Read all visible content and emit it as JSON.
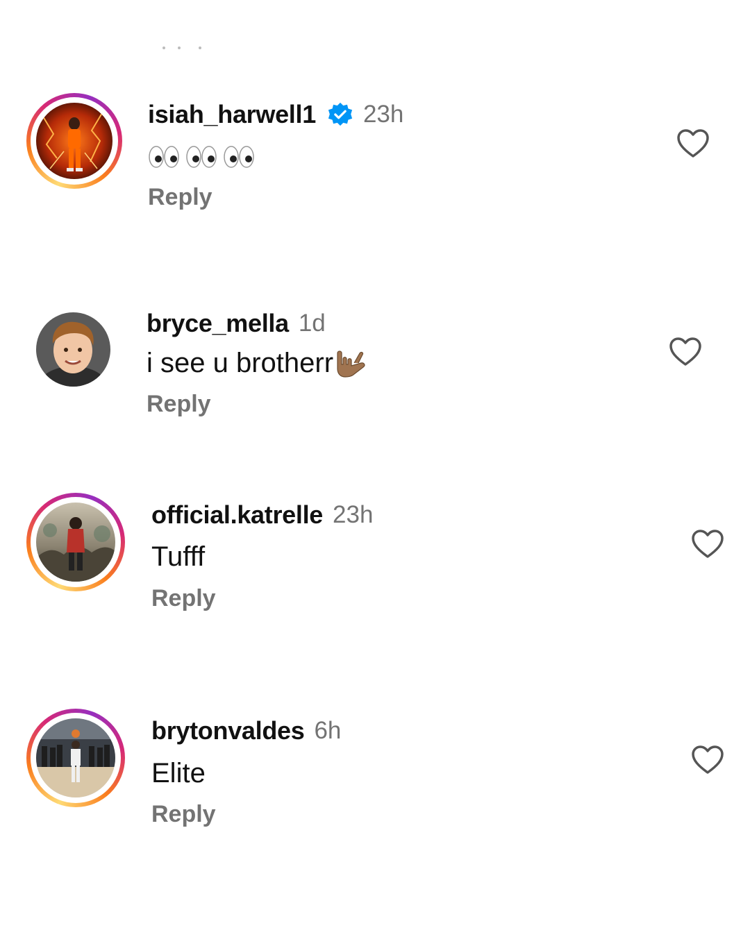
{
  "comments": [
    {
      "username": "isiah_harwell1",
      "verified": true,
      "time": "23h",
      "text": "👀👀👀",
      "reply_label": "Reply",
      "ring": true
    },
    {
      "username": "bryce_mella",
      "verified": false,
      "time": "1d",
      "text": "i see u brotherr",
      "emoji": "🤟🏽",
      "reply_label": "Reply",
      "ring": false
    },
    {
      "username": "official.katrelle",
      "verified": false,
      "time": "23h",
      "text": "Tufff",
      "reply_label": "Reply",
      "ring": true
    },
    {
      "username": "brytonvaldes",
      "verified": false,
      "time": "6h",
      "text": "Elite",
      "reply_label": "Reply",
      "ring": true
    }
  ],
  "colors": {
    "secondary_text": "#737373",
    "verified_blue": "#0095f6",
    "story_ring": [
      "#feda75",
      "#fa7e1e",
      "#d62976",
      "#962fbf"
    ]
  },
  "icons": {
    "like": "heart-outline-icon",
    "verified": "verified-badge-icon"
  }
}
